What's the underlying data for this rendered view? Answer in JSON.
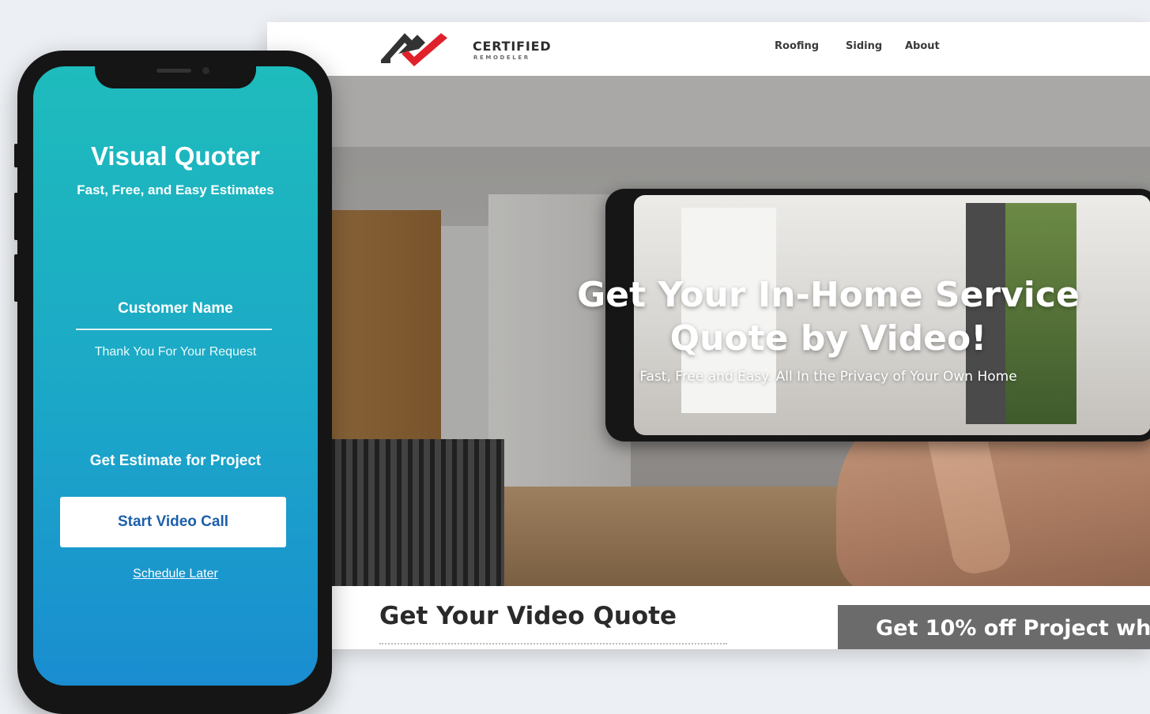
{
  "website": {
    "logo": {
      "name": "CERTIFIED",
      "subline": "REMODELER",
      "colors": {
        "roof": "#333333",
        "check": "#e0202b"
      }
    },
    "nav": [
      {
        "label": "Roofing"
      },
      {
        "label": "Siding"
      },
      {
        "label": "About"
      }
    ],
    "hero": {
      "title": "Get Your In-Home Service Quote by Video!",
      "subtitle": "Fast, Free and Easy. All In the Privacy of Your Own Home"
    },
    "section": {
      "title": "Get Your Video Quote",
      "promo": "Get 10% off Project wh"
    }
  },
  "mobile_app": {
    "title": "Visual Quoter",
    "subtitle": "Fast, Free, and Easy Estimates",
    "customer_name": "Customer Name",
    "thanks": "Thank You For Your Request",
    "estimate_label": "Get Estimate for Project",
    "start_button": "Start Video Call",
    "schedule_link": "Schedule Later",
    "colors": {
      "gradient_top": "#1ebcbc",
      "gradient_bottom": "#1a8dd0",
      "button_text": "#1d5fa9"
    }
  }
}
